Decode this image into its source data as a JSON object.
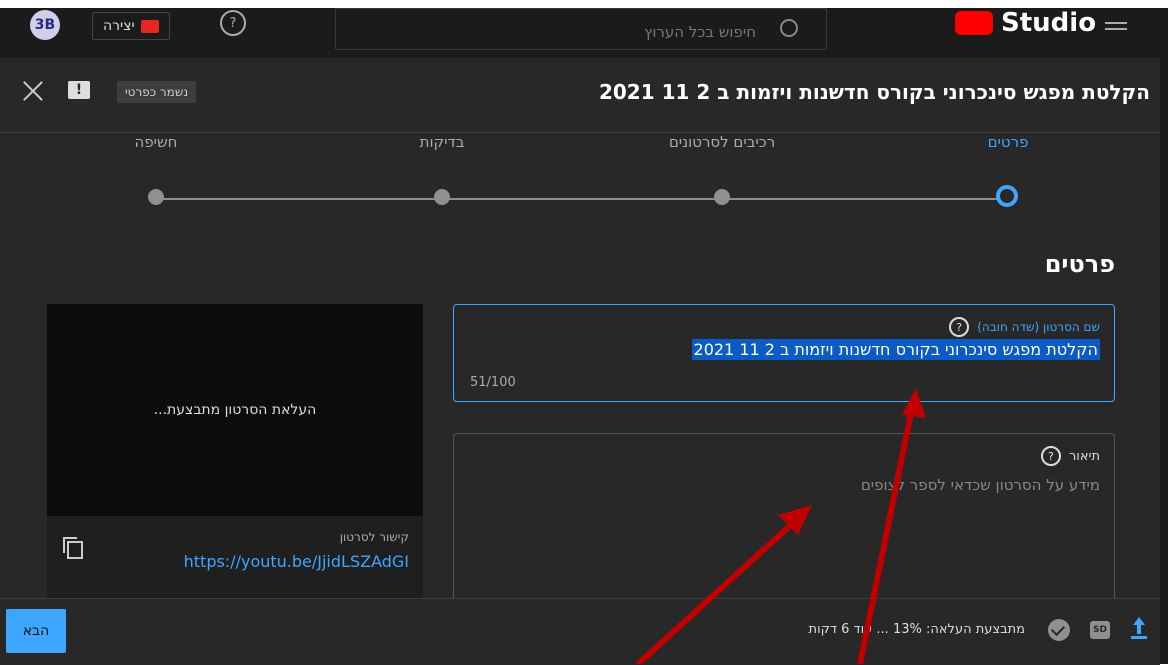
{
  "topbar": {
    "logo_text": "3B",
    "create_label": "יצירה",
    "search_placeholder": "חיפוש בכל הערוץ",
    "studio_label": "Studio"
  },
  "dialog": {
    "saved_label": "נשמר כפרטי",
    "title": "הקלטת מפגש סינכרוני בקורס חדשנות ויזמות ב 2 11 2021"
  },
  "steps": [
    {
      "label": "פרטים",
      "active": true
    },
    {
      "label": "רכיבים לסרטונים",
      "active": false
    },
    {
      "label": "בדיקות",
      "active": false
    },
    {
      "label": "חשיפה",
      "active": false
    }
  ],
  "details": {
    "section_title": "פרטים",
    "name_label": "שם הסרטון (שדה חובה)",
    "name_value": "הקלטת מפגש סינכרוני בקורס חדשנות ויזמות ב 2 11 2021",
    "name_count": "51/100",
    "desc_label": "תיאור",
    "desc_placeholder": "מידע על הסרטון שכדאי לספר לצופים"
  },
  "preview": {
    "uploading_msg": "העלאת הסרטון מתבצעת...",
    "link_label": "קישור לסרטון",
    "link": "https://youtu.be/JjidLSZAdGI"
  },
  "footer": {
    "next_label": "הבא",
    "status": "מתבצעת העלאה: 13% ... עוד 6 דקות",
    "sd_badge": "SD"
  },
  "colors": {
    "accent": "#3ea6ff",
    "annotation_arrow": "#c00000"
  }
}
